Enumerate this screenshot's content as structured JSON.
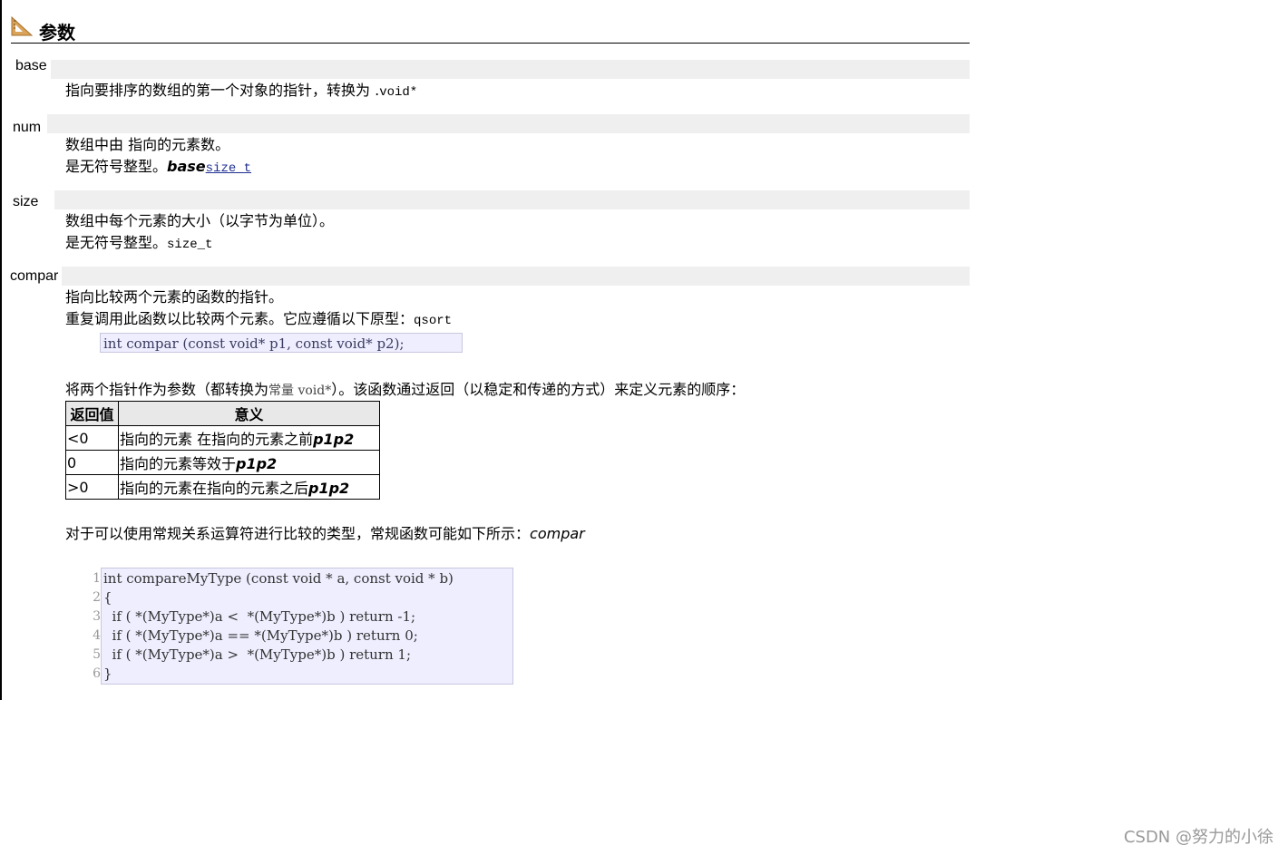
{
  "section": {
    "title": "参数",
    "icon": "ruler-icon"
  },
  "params": {
    "base": {
      "name": "base",
      "line1": "指向要排序的数组的第一个对象的指针，转换为 .",
      "line1_code": "void*"
    },
    "num": {
      "name": "num",
      "line1": "数组中由 指向的元素数。",
      "line2": "是无符号整型。",
      "line2_em": "base",
      "line2_link": "size_t"
    },
    "size": {
      "name": "size",
      "line1": "数组中每个元素的大小（以字节为单位）。",
      "line2": "是无符号整型。",
      "line2_code": "size_t"
    },
    "compar": {
      "name": "compar",
      "line1": "指向比较两个元素的函数的指针。",
      "line2": "重复调用此函数以比较两个元素。它应遵循以下原型：",
      "line2_code": "qsort",
      "prototype": "int compar (const void* p1, const void* p2);",
      "line3_a": "将两个指针作为参数（都转换为",
      "line3_code": "常量 void*",
      "line3_b": "）。该函数通过返回（以稳定和传递的方式）来定义元素的顺序：",
      "table": {
        "headers": [
          "返回值",
          "意义"
        ],
        "rows": [
          {
            "value": "<0",
            "meaning": "指向的元素 在指向的元素之前",
            "em": "p1p2"
          },
          {
            "value": "0",
            "meaning": "指向的元素等效于",
            "em": "p1p2"
          },
          {
            "value": ">0",
            "meaning": "指向的元素在指向的元素之后",
            "em": "p1p2"
          }
        ]
      },
      "line4": "对于可以使用常规关系运算符进行比较的类型，常规函数可能如下所示：",
      "line4_em": "compar",
      "code_line_numbers": [
        "1",
        "2",
        "3",
        "4",
        "5",
        "6"
      ],
      "code_lines": [
        "int compareMyType (const void * a, const void * b)",
        "{",
        "  if ( *(MyType*)a <  *(MyType*)b ) return -1;",
        "  if ( *(MyType*)a == *(MyType*)b ) return 0;",
        "  if ( *(MyType*)a >  *(MyType*)b ) return 1;",
        "}"
      ]
    }
  },
  "watermark": "CSDN @努力的小徐"
}
